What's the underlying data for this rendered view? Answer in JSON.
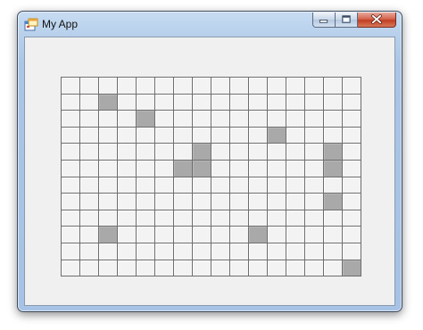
{
  "window": {
    "title": "My App",
    "app_icon": "windows-forms-app-icon",
    "caption_buttons": [
      "minimize-icon",
      "maximize-icon",
      "close-icon"
    ]
  },
  "grid": {
    "rows": 12,
    "columns": 16,
    "empty_color": "#f3f3f3",
    "filled_color": "#a9a9a9",
    "gridline_color": "#6d6d6d",
    "filled_cells": [
      [
        1,
        2
      ],
      [
        2,
        4
      ],
      [
        3,
        11
      ],
      [
        4,
        7
      ],
      [
        4,
        14
      ],
      [
        5,
        6
      ],
      [
        5,
        7
      ],
      [
        5,
        14
      ],
      [
        7,
        14
      ],
      [
        9,
        2
      ],
      [
        9,
        10
      ],
      [
        11,
        15
      ]
    ]
  }
}
